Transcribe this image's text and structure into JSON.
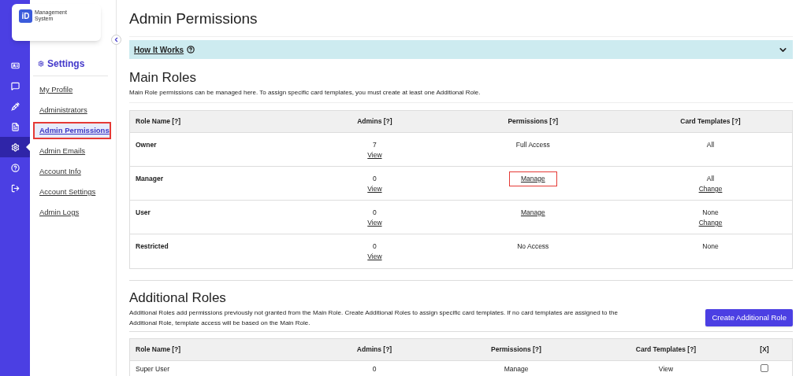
{
  "logo": {
    "mark": "iD",
    "title": "Management System"
  },
  "rail": [
    {
      "selected": false
    },
    {
      "selected": false
    },
    {
      "selected": false
    },
    {
      "selected": false
    },
    {
      "selected": true
    },
    {
      "selected": false
    },
    {
      "selected": false
    }
  ],
  "sidebar": {
    "heading": "Settings",
    "items": [
      {
        "label": "My Profile",
        "selected": false
      },
      {
        "label": "Administrators",
        "selected": false
      },
      {
        "label": "Admin Permissions",
        "selected": true
      },
      {
        "label": "Admin Emails",
        "selected": false
      },
      {
        "label": "Account Info",
        "selected": false
      },
      {
        "label": "Account Settings",
        "selected": false
      },
      {
        "label": "Admin Logs",
        "selected": false
      }
    ]
  },
  "page_title": "Admin Permissions",
  "how_it_works": {
    "label": "How It Works",
    "expanded": false
  },
  "main_roles": {
    "title": "Main Roles",
    "description": "Main Role permissions can be managed here. To assign specific card templates, you must create at least one Additional Role.",
    "columns": [
      "Role Name [?]",
      "Admins [?]",
      "Permissions [?]",
      "Card Templates [?]"
    ],
    "rows": [
      {
        "name": "Owner",
        "admins": "7",
        "admins_link": "View",
        "permissions": {
          "text": "Full Access",
          "link": false,
          "highlighted": false
        },
        "templates": "All",
        "templates_link": ""
      },
      {
        "name": "Manager",
        "admins": "0",
        "admins_link": "View",
        "permissions": {
          "text": "Manage",
          "link": true,
          "highlighted": true
        },
        "templates": "All",
        "templates_link": "Change"
      },
      {
        "name": "User",
        "admins": "0",
        "admins_link": "View",
        "permissions": {
          "text": "Manage",
          "link": true,
          "highlighted": false
        },
        "templates": "None",
        "templates_link": "Change"
      },
      {
        "name": "Restricted",
        "admins": "0",
        "admins_link": "View",
        "permissions": {
          "text": "No Access",
          "link": false,
          "highlighted": false
        },
        "templates": "None",
        "templates_link": ""
      }
    ]
  },
  "additional_roles": {
    "title": "Additional Roles",
    "description": "Additional Roles add permissions previously not granted from the Main Role. Create Additional Roles to assign specific card templates. If no card templates are assigned to the Additional Role, template access will be based on the Main Role.",
    "button": "Create Additional Role",
    "columns": [
      "Role Name [?]",
      "Admins [?]",
      "Permissions [?]",
      "Card Templates [?]",
      "[X]"
    ],
    "rows": [
      {
        "name": "Super User",
        "admins": "0",
        "permissions": "Manage",
        "templates": "View",
        "checked": false
      }
    ]
  }
}
